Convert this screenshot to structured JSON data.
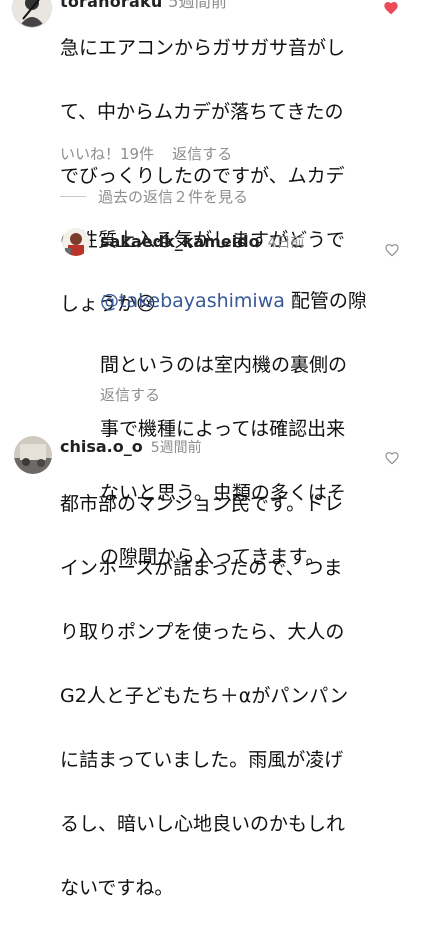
{
  "top_comment": {
    "username_partial": "toranoraku",
    "timestamp_partial": "5週間前",
    "text": "急にエアコンからガサガサ音がして、中からムカデが落ちてきたのでびっくりしたのですが、ムカデの性質上入る気がしますがどうでしょうか😢",
    "line1": "急にエアコンからガサガサ音がし",
    "line2": "て、中からムカデが落ちてきたの",
    "line3": "でびっくりしたのですが、ムカデ",
    "line4": "の性質上入る気がしますがどうで",
    "line5": "しょうか😢",
    "likes_label": "いいね！19件",
    "reply_label": "返信する",
    "liked": true
  },
  "view_replies": {
    "label": "過去の返信２件を見る"
  },
  "reply": {
    "username": "sakaedk_kameido",
    "timestamp": "4日前",
    "mention": "@takebayashimiwa",
    "line1_rest": " 配管の隙",
    "line2": "間というのは室内機の裏側の",
    "line3": "事で機種によっては確認出来",
    "line4": "ないと思う。虫類の多くはそ",
    "line5": "の隙間から入ってきます。",
    "reply_label": "返信する"
  },
  "comment2": {
    "username": "chisa.o_o",
    "timestamp": "5週間前",
    "line1": "都市部のマンション民です。ドレ",
    "line2": "インホースが詰まったので、つま",
    "line3": "り取りポンプを使ったら、大人の",
    "line4": "G2人と子どもたち＋αがパンパン",
    "line5": "に詰まっていました。雨風が凌げ",
    "line6": "るし、暗いし心地良いのかもしれ",
    "line7": "ないですね。"
  },
  "icons": {
    "liked_heart": "heart-filled-icon",
    "heart": "heart-outline-icon"
  },
  "colors": {
    "liked_heart": "#ed4956",
    "muted_text": "#8e8e8e",
    "mention": "#385898"
  }
}
